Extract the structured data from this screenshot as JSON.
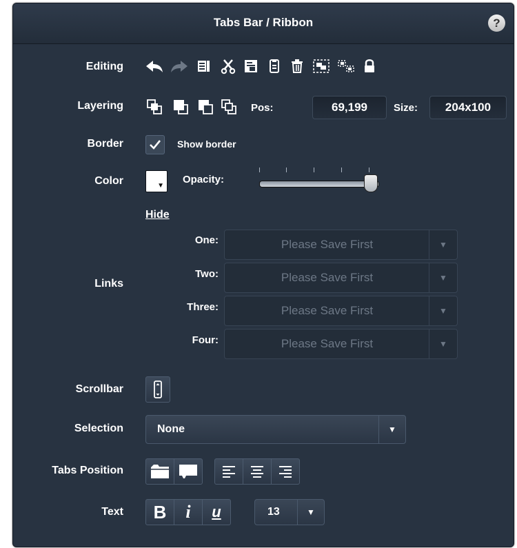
{
  "title": "Tabs Bar / Ribbon",
  "help_label": "?",
  "editing": {
    "label": "Editing",
    "icons": [
      "undo-icon",
      "redo-icon",
      "copy-icon",
      "cut-icon",
      "paste-icon",
      "paste-style-icon",
      "delete-icon",
      "group-icon",
      "ungroup-icon",
      "lock-icon"
    ]
  },
  "layering": {
    "label": "Layering",
    "icons": [
      "bring-to-front-icon",
      "bring-forward-icon",
      "send-backward-icon",
      "send-to-back-icon"
    ],
    "pos_label": "Pos:",
    "pos_value": "69,199",
    "size_label": "Size:",
    "size_value": "204x100"
  },
  "border": {
    "label": "Border",
    "checkbox_label": "Show border",
    "checked": true
  },
  "color": {
    "label": "Color",
    "swatch_color": "#ffffff",
    "opacity_label": "Opacity:",
    "opacity_value": 1.0
  },
  "links": {
    "label": "Links",
    "hide_label": "Hide",
    "items": [
      {
        "label": "One:",
        "value": "Please Save First"
      },
      {
        "label": "Two:",
        "value": "Please Save First"
      },
      {
        "label": "Three:",
        "value": "Please Save First"
      },
      {
        "label": "Four:",
        "value": "Please Save First"
      }
    ]
  },
  "scrollbar": {
    "label": "Scrollbar",
    "icon": "scrollbar-icon"
  },
  "selection": {
    "label": "Selection",
    "value": "None"
  },
  "tabs_position": {
    "label": "Tabs Position",
    "position_icons": [
      "tabs-top-icon",
      "tabs-bottom-icon"
    ],
    "align_icons": [
      "align-left-icon",
      "align-center-icon",
      "align-right-icon"
    ]
  },
  "text": {
    "label": "Text",
    "bold": "B",
    "italic": "i",
    "underline": "u",
    "size_value": "13"
  },
  "colors": {
    "panel": "#283341",
    "title_bar": "#2a3544",
    "text": "#ffffff",
    "disabled_text": "#6d7886"
  }
}
